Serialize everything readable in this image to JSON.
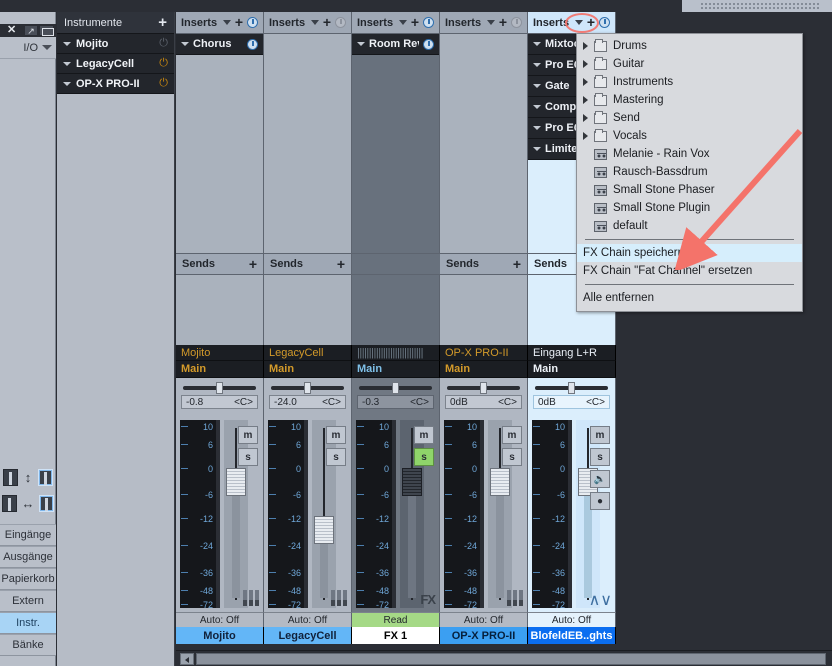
{
  "window": {
    "close_label": "✕"
  },
  "left_sidebar": {
    "io_label": "I/O",
    "buttons": [
      {
        "label": "Eingänge",
        "active": false
      },
      {
        "label": "Ausgänge",
        "active": false
      },
      {
        "label": "Papierkorb",
        "active": false
      },
      {
        "label": "Extern",
        "active": false
      },
      {
        "label": "Instr.",
        "active": true
      },
      {
        "label": "Bänke",
        "active": false
      }
    ]
  },
  "instruments_panel": {
    "title": "Instrumente",
    "add_label": "+",
    "items": [
      {
        "name": "Mojito",
        "power": "off"
      },
      {
        "name": "LegacyCell",
        "power": "on"
      },
      {
        "name": "OP-X PRO-II",
        "power": "on"
      }
    ]
  },
  "mixer": {
    "inserts_label": "Inserts",
    "sends_label": "Sends",
    "add_label": "+",
    "scale_ticks": [
      "10",
      "6",
      "0",
      "-6",
      "-12",
      "-24",
      "-36",
      "-48",
      "-72"
    ],
    "channels": [
      {
        "name": "Mojito",
        "bus": "Main",
        "pan": "-0.8",
        "pan_center": "<C>",
        "inserts": [
          "Chorus"
        ],
        "insert_power": "on",
        "automation": "Auto: Off",
        "mute_label": "m",
        "solo_label": "s",
        "solo_active": false,
        "header_power": "on",
        "strip_color": "#63b6f7",
        "name_style": "b1"
      },
      {
        "name": "LegacyCell",
        "bus": "Main",
        "pan": "-24.0",
        "pan_center": "<C>",
        "inserts": [],
        "insert_power": "off",
        "automation": "Auto: Off",
        "mute_label": "m",
        "solo_label": "s",
        "solo_active": false,
        "header_power": "off",
        "strip_color": "#63b6f7",
        "name_style": "b1"
      },
      {
        "name": "FX 1",
        "bus": "Main",
        "pan": "-0.3",
        "pan_center": "<C>",
        "inserts": [
          "Room Revert"
        ],
        "insert_power": "on",
        "automation": "Read",
        "mute_label": "m",
        "solo_label": "s",
        "solo_active": true,
        "header_power": "on",
        "glyph": "FX",
        "name_style": "w"
      },
      {
        "name": "OP-X PRO-II",
        "bus": "Main",
        "pan": "0dB",
        "pan_center": "<C>",
        "inserts": [],
        "insert_power": "off",
        "automation": "Auto: Off",
        "mute_label": "m",
        "solo_label": "s",
        "solo_active": false,
        "header_power": "off",
        "name_style": "b2"
      },
      {
        "name": "BlofeldEB..ghts",
        "bus": "Main",
        "pan": "0dB",
        "pan_center": "<C>",
        "inserts": [
          "Mixtool",
          "Pro EQ",
          "Gate",
          "Compressor",
          "Pro EQ",
          "Limiter"
        ],
        "insert_power": "on",
        "automation": "Auto: Off",
        "mute_label": "m",
        "solo_label": "s",
        "solo_active": false,
        "header_power": "on",
        "name_style": "b3",
        "input_label": "Eingang L+R",
        "extra_buttons": [
          "monitor",
          "record"
        ]
      }
    ]
  },
  "context_menu": {
    "folders": [
      "Drums",
      "Guitar",
      "Instruments",
      "Mastering",
      "Send",
      "Vocals"
    ],
    "presets": [
      "Melanie - Rain Vox",
      "Rausch-Bassdrum",
      "Small Stone Phaser",
      "Small Stone Plugin",
      "default"
    ],
    "actions": [
      {
        "label": "FX Chain speichern...",
        "highlighted": true
      },
      {
        "label": "FX Chain \"Fat Channel\" ersetzen",
        "highlighted": false
      }
    ],
    "remove_all": "Alle entfernen"
  },
  "annotation": {
    "color": "#f4736a"
  }
}
